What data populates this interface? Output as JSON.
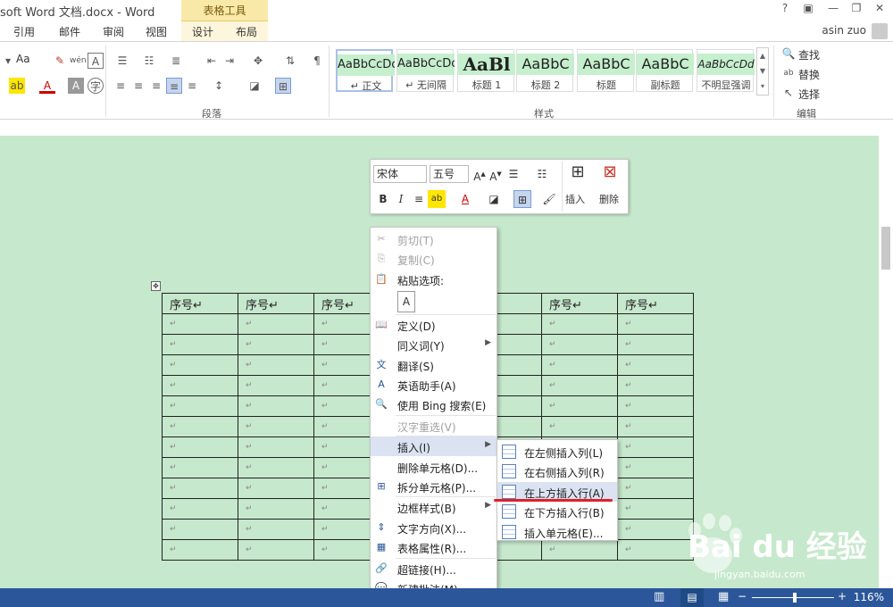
{
  "title_bar": {
    "document_title": "soft Word 文档.docx - Word",
    "table_tools_label": "表格工具",
    "help_label": "?",
    "user_name": "asin zuo"
  },
  "tabs": [
    {
      "label": "引用"
    },
    {
      "label": "邮件"
    },
    {
      "label": "审阅"
    },
    {
      "label": "视图"
    },
    {
      "label": "设计"
    },
    {
      "label": "布局"
    }
  ],
  "ribbon": {
    "paragraph_group_label": "段落",
    "styles_group_label": "样式",
    "edit_group_label": "编辑",
    "font_size_btn": "Aa",
    "styles": [
      {
        "sample": "AaBbCcDc",
        "name": "↵ 正文"
      },
      {
        "sample": "AaBbCcDc",
        "name": "↵ 无间隔"
      },
      {
        "sample": "AaBl",
        "name": "标题 1"
      },
      {
        "sample": "AaBbC",
        "name": "标题 2"
      },
      {
        "sample": "AaBbC",
        "name": "标题"
      },
      {
        "sample": "AaBbC",
        "name": "副标题"
      },
      {
        "sample": "AaBbCcDd",
        "name": "不明显强调"
      }
    ],
    "find_label": "查找",
    "replace_label": "替换",
    "select_label": "选择"
  },
  "mini_toolbar": {
    "font_name": "宋体",
    "font_size": "五号",
    "insert_label": "插入",
    "delete_label": "删除"
  },
  "table": {
    "header": [
      "序号↵",
      "序号↵",
      "序号↵",
      "",
      "",
      "序号↵",
      "序号↵"
    ],
    "empty_cell_mark": "↵",
    "row_count": 13
  },
  "context_menu": {
    "items": [
      {
        "label": "剪切(T)",
        "icon": "scissors-icon",
        "disabled": true
      },
      {
        "label": "复制(C)",
        "icon": "copy-icon",
        "disabled": true
      },
      {
        "label": "粘贴选项:",
        "icon": "paste-icon",
        "disabled": false
      },
      {
        "label": "定义(D)",
        "icon": "define-icon",
        "disabled": false
      },
      {
        "label": "同义词(Y)",
        "icon": "",
        "disabled": false,
        "submenu": true
      },
      {
        "label": "翻译(S)",
        "icon": "translate-icon",
        "disabled": false
      },
      {
        "label": "英语助手(A)",
        "icon": "english-assistant-icon",
        "disabled": false
      },
      {
        "label": "使用 Bing 搜索(E)",
        "icon": "bing-search-icon",
        "disabled": false
      },
      {
        "label": "汉字重选(V)",
        "icon": "",
        "disabled": true
      },
      {
        "label": "插入(I)",
        "icon": "",
        "disabled": false,
        "submenu": true,
        "highlighted": true
      },
      {
        "label": "删除单元格(D)...",
        "icon": "",
        "disabled": false
      },
      {
        "label": "拆分单元格(P)...",
        "icon": "split-cell-icon",
        "disabled": false
      },
      {
        "label": "边框样式(B)",
        "icon": "",
        "disabled": false,
        "submenu": true
      },
      {
        "label": "文字方向(X)...",
        "icon": "text-direction-icon",
        "disabled": false
      },
      {
        "label": "表格属性(R)...",
        "icon": "table-properties-icon",
        "disabled": false
      },
      {
        "label": "超链接(H)...",
        "icon": "hyperlink-icon",
        "disabled": false
      },
      {
        "label": "新建批注(M)",
        "icon": "comment-icon",
        "disabled": false
      }
    ]
  },
  "insert_submenu": {
    "items": [
      {
        "label": "在左侧插入列(L)"
      },
      {
        "label": "在右侧插入列(R)"
      },
      {
        "label": "在上方插入行(A)",
        "highlighted": true
      },
      {
        "label": "在下方插入行(B)"
      },
      {
        "label": "插入单元格(E)..."
      }
    ]
  },
  "status_bar": {
    "zoom": "116%"
  },
  "watermark": {
    "text": "Bai du 经验",
    "url": "jingyan.baidu.com"
  },
  "colors": {
    "page_bg": "#c6e8cc",
    "status_bar": "#2b579a",
    "highlight": "#dbe3f2",
    "annotation_red": "#e0202a"
  }
}
